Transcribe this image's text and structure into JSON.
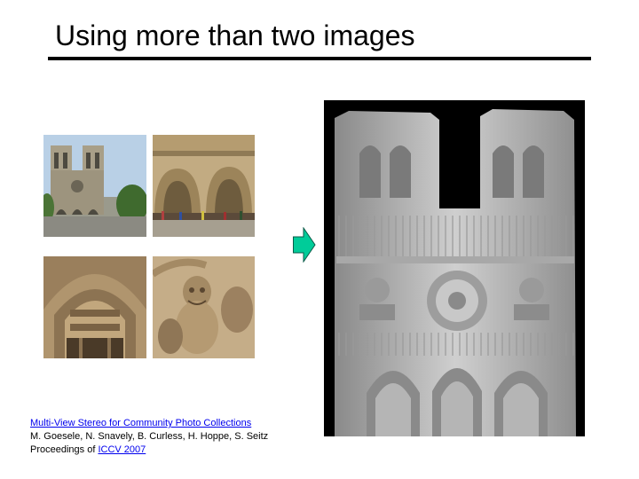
{
  "slide": {
    "title": "Using more than two images"
  },
  "citation": {
    "link_text": "Multi-View Stereo for Community Photo Collections",
    "authors": "M. Goesele, N. Snavely, B. Curless, H. Hoppe, S. Seitz",
    "proceedings_prefix": "Proceedings of ",
    "proceedings_link": "ICCV 2007"
  },
  "arrow": {
    "fill_color": "#00cc99",
    "icon": "right-arrow-icon"
  },
  "model": {
    "background": "#000000",
    "surface_color": "#bfbfbf"
  }
}
